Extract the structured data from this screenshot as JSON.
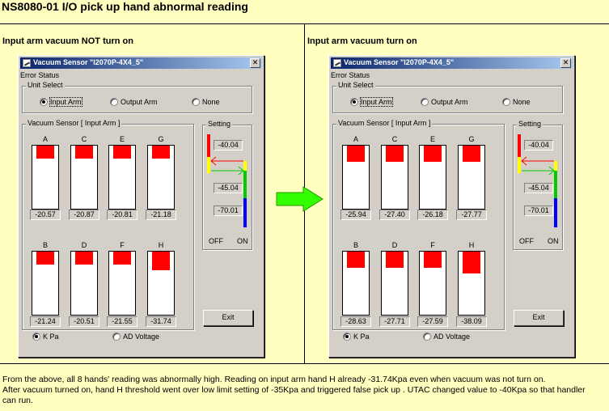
{
  "title": "NS8080-01 I/O pick up hand abnormal reading",
  "left_label": "Input arm vacuum NOT turn on",
  "right_label": "Input arm vacuum turn on",
  "footer": {
    "line1": "From the above, all 8 hands' reading was abnormally high. Reading on input arm hand H already -31.74Kpa even when vacuum was not turn on.",
    "line2": "After vacuum turned on, hand H threshold went over low limit setting of -35Kpa and triggered false pick up . UTAC changed value to -40Kpa so that handler",
    "line3": "can run."
  },
  "colors": {
    "bar": "#ff0000",
    "title_from": "#0a246a",
    "title_to": "#a6caf0",
    "arrow": "#33ff00",
    "background": "#ffffc0"
  },
  "dialogs": [
    {
      "window_title": "Vacuum Sensor \"I2070P-4X4_5\"",
      "error_status": "Error Status",
      "unit_select_label": "Unit Select",
      "unit_options": [
        "Input Arm",
        "Output Arm",
        "None"
      ],
      "unit_selected": "Input Arm",
      "sensor_group_label": "Vacuum Sensor [ Input Arm ]",
      "setting_label": "Setting",
      "settings": [
        "-40.04",
        "-45.04",
        "-70.01"
      ],
      "off_label": "OFF",
      "on_label": "ON",
      "exit_label": "Exit",
      "units": [
        "K Pa",
        "AD Voltage"
      ],
      "units_selected": "K Pa",
      "hands": [
        {
          "name": "A",
          "value": "-20.57",
          "level": 0.2
        },
        {
          "name": "C",
          "value": "-20.87",
          "level": 0.2
        },
        {
          "name": "E",
          "value": "-20.81",
          "level": 0.2
        },
        {
          "name": "G",
          "value": "-21.18",
          "level": 0.2
        },
        {
          "name": "B",
          "value": "-21.24",
          "level": 0.2
        },
        {
          "name": "D",
          "value": "-20.51",
          "level": 0.2
        },
        {
          "name": "F",
          "value": "-21.55",
          "level": 0.2
        },
        {
          "name": "H",
          "value": "-31.74",
          "level": 0.3
        }
      ]
    },
    {
      "window_title": "Vacuum Sensor \"I2070P-4X4_5\"",
      "error_status": "Error Status",
      "unit_select_label": "Unit Select",
      "unit_options": [
        "Input Arm",
        "Output Arm",
        "None"
      ],
      "unit_selected": "Input Arm",
      "sensor_group_label": "Vacuum Sensor [ Input Arm ]",
      "setting_label": "Setting",
      "settings": [
        "-40.04",
        "-45.04",
        "-70.01"
      ],
      "off_label": "OFF",
      "on_label": "ON",
      "exit_label": "Exit",
      "units": [
        "K Pa",
        "AD Voltage"
      ],
      "units_selected": "K Pa",
      "hands": [
        {
          "name": "A",
          "value": "-25.94",
          "level": 0.25
        },
        {
          "name": "C",
          "value": "-27.40",
          "level": 0.25
        },
        {
          "name": "E",
          "value": "-26.18",
          "level": 0.25
        },
        {
          "name": "G",
          "value": "-27.77",
          "level": 0.25
        },
        {
          "name": "B",
          "value": "-28.63",
          "level": 0.25
        },
        {
          "name": "D",
          "value": "-27.71",
          "level": 0.25
        },
        {
          "name": "F",
          "value": "-27.59",
          "level": 0.25
        },
        {
          "name": "H",
          "value": "-38.09",
          "level": 0.35
        }
      ]
    }
  ]
}
